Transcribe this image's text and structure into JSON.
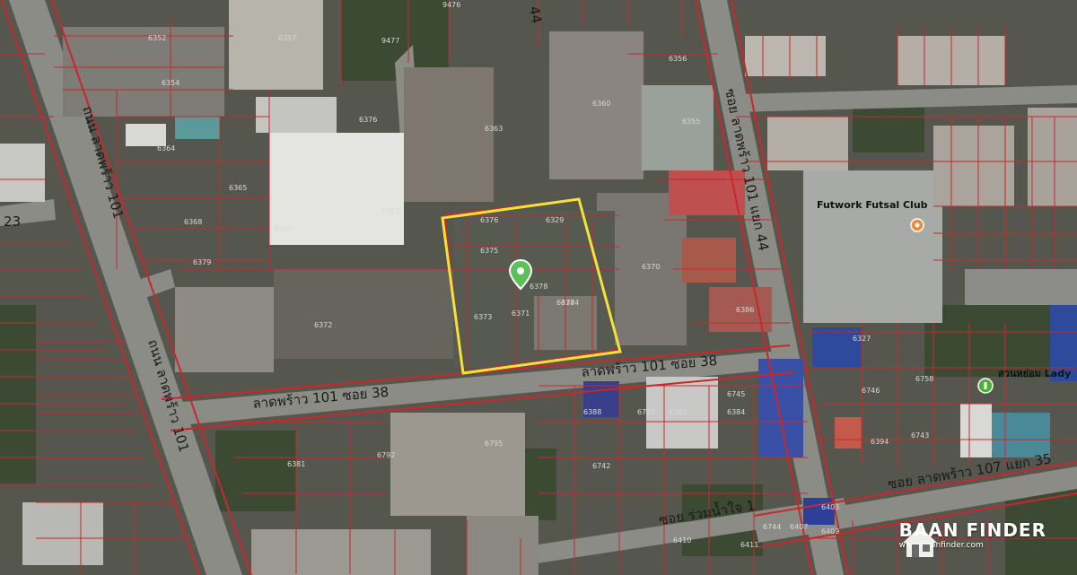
{
  "map": {
    "roads": {
      "v_left": "ถนน ลาดพร้าว 101",
      "v_left_upper": "ถนน ลาดพร้าว 101",
      "h_main": "ลาดพร้าว 101 ซอย 38",
      "h_main_right": "ลาดพร้าว 101 ซอย 38",
      "v_right": "ซอย ลาดพร้าว 101 แยก 44",
      "bottom_right": "ซอย ลาดพร้าว 107 แยก 35",
      "bottom_mid": "ซอย ร่วมน้ำใจ 1",
      "left_edge": "23",
      "top_44": "44"
    },
    "pois": {
      "futsal": "Futwork Futsal Club",
      "lady": "สวนหย่อม Lady"
    },
    "parcels": [
      "6352",
      "6357",
      "9477",
      "9476",
      "6354",
      "6360",
      "6356",
      "6355",
      "6376",
      "6363",
      "6364",
      "6365",
      "6368",
      "6367",
      "6362",
      "6379",
      "6376",
      "6329",
      "6375",
      "6378",
      "6378",
      "6374",
      "6371",
      "6372",
      "6373",
      "6370",
      "6386",
      "6327",
      "6758",
      "6746",
      "6745",
      "6384",
      "6385",
      "6381",
      "6795",
      "6792",
      "6793",
      "6388",
      "6394",
      "6743",
      "6742",
      "6744",
      "6407",
      "6409",
      "6410",
      "6411",
      "6403"
    ]
  },
  "brand": {
    "name": "BAAN FINDER",
    "url": "www.baanfinder.com"
  },
  "colors": {
    "parcel_line": "#c8282a",
    "highlight": "#f4e23a",
    "pin": "#5cc05a"
  }
}
